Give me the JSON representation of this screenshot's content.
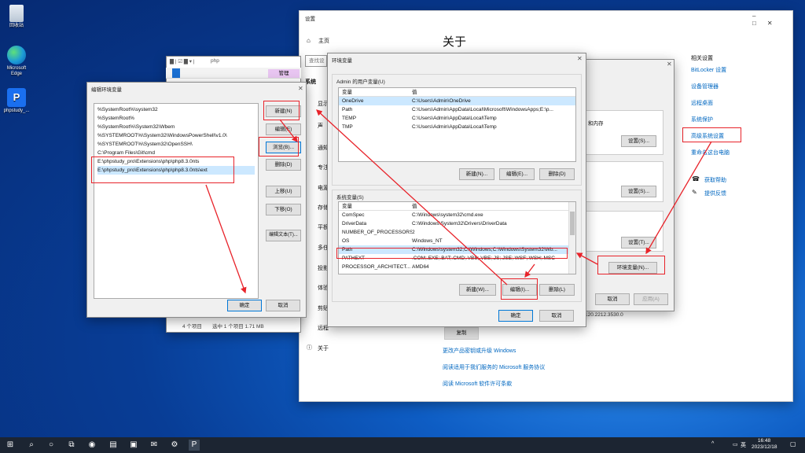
{
  "desktop": {
    "icons": [
      {
        "label": "回收站",
        "icon": "recycle-bin-icon"
      },
      {
        "label": "Microsoft Edge",
        "icon": "edge-icon"
      },
      {
        "label": "phpstudy_...",
        "icon": "phpstudy-icon"
      }
    ]
  },
  "settings": {
    "title": "设置",
    "home": "主页",
    "search_placeholder": "查找设",
    "section": "系统",
    "nav": [
      "显示",
      "声",
      "通知",
      "专注",
      "电源",
      "存储",
      "平板",
      "多任",
      "投影",
      "体验",
      "剪贴",
      "远程",
      "关于"
    ],
    "page_title": "关于",
    "related_title": "相关设置",
    "related_links": [
      "BitLocker 设置",
      "设备管理器",
      "远程桌面",
      "系统保护",
      "高级系统设置",
      "重命名这台电脑"
    ],
    "help": [
      "获取帮助",
      "提供反馈"
    ],
    "copy_button": "复制",
    "links": [
      "更改产品密钥或升级 Windows",
      "阅读适用于我们服务的 Microsoft 服务协议",
      "阅读 Microsoft 软件许可条款"
    ],
    "version_partial": "120.2212.3530.0"
  },
  "explorer": {
    "title": "php",
    "manage_tab": "管理",
    "status": "4 个项目",
    "status_selected": "选中 1 个项目  1.71 MB"
  },
  "sysprops": {
    "memory_fragment": "和内存",
    "settings_buttons": [
      "设置(S)...",
      "设置(S)...",
      "设置(T)..."
    ],
    "env_button": "环境变量(N)...",
    "ok": "确定",
    "cancel": "取消",
    "apply": "应用(A)"
  },
  "env_dialog": {
    "title": "环境变量",
    "user_section": "Admin 的用户变量(U)",
    "col_var": "变量",
    "col_val": "值",
    "user_vars": [
      {
        "name": "OneDrive",
        "value": "C:\\Users\\Admin\\OneDrive"
      },
      {
        "name": "Path",
        "value": "C:\\Users\\Admin\\AppData\\Local\\Microsoft\\WindowsApps;E:\\p..."
      },
      {
        "name": "TEMP",
        "value": "C:\\Users\\Admin\\AppData\\Local\\Temp"
      },
      {
        "name": "TMP",
        "value": "C:\\Users\\Admin\\AppData\\Local\\Temp"
      }
    ],
    "user_buttons": [
      "新建(N)...",
      "编辑(E)...",
      "删除(D)"
    ],
    "system_section": "系统变量(S)",
    "system_vars": [
      {
        "name": "ComSpec",
        "value": "C:\\Windows\\system32\\cmd.exe"
      },
      {
        "name": "DriverData",
        "value": "C:\\Windows\\System32\\Drivers\\DriverData"
      },
      {
        "name": "NUMBER_OF_PROCESSORS",
        "value": "2"
      },
      {
        "name": "OS",
        "value": "Windows_NT"
      },
      {
        "name": "Path",
        "value": "C:\\Windows\\system32;C:\\Windows;C:\\Windows\\System32\\Wb..."
      },
      {
        "name": "PATHEXT",
        "value": ".COM;.EXE;.BAT;.CMD;.VBS;.VBE;.JS;.JSE;.WSF;.WSH;.MSC"
      },
      {
        "name": "PROCESSOR_ARCHITECT...",
        "value": "AMD64"
      }
    ],
    "system_buttons": [
      "新建(W)...",
      "编辑(I)...",
      "删除(L)"
    ],
    "ok": "确定",
    "cancel": "取消"
  },
  "edit_dialog": {
    "title": "编辑环境变量",
    "entries": [
      "%SystemRoot%\\system32",
      "%SystemRoot%",
      "%SystemRoot%\\System32\\Wbem",
      "%SYSTEMROOT%\\System32\\WindowsPowerShell\\v1.0\\",
      "%SYSTEMROOT%\\System32\\OpenSSH\\",
      "C:\\Program Files\\Git\\cmd",
      "E:\\phpstudy_pro\\Extensions\\php\\php8.3.0nts",
      "E:\\phpstudy_pro\\Extensions\\php\\php8.3.0nts\\ext"
    ],
    "buttons": [
      "新建(N)",
      "编辑(E)",
      "浏览(B)...",
      "删除(D)",
      "上移(U)",
      "下移(O)",
      "编辑文本(T)..."
    ],
    "ok": "确定",
    "cancel": "取消"
  },
  "taskbar": {
    "time": "16:48",
    "date": "2023/12/18",
    "ime": "英"
  },
  "colors": {
    "annotation": "#e8232a",
    "link": "#0067c0",
    "accent": "#0078d7"
  }
}
